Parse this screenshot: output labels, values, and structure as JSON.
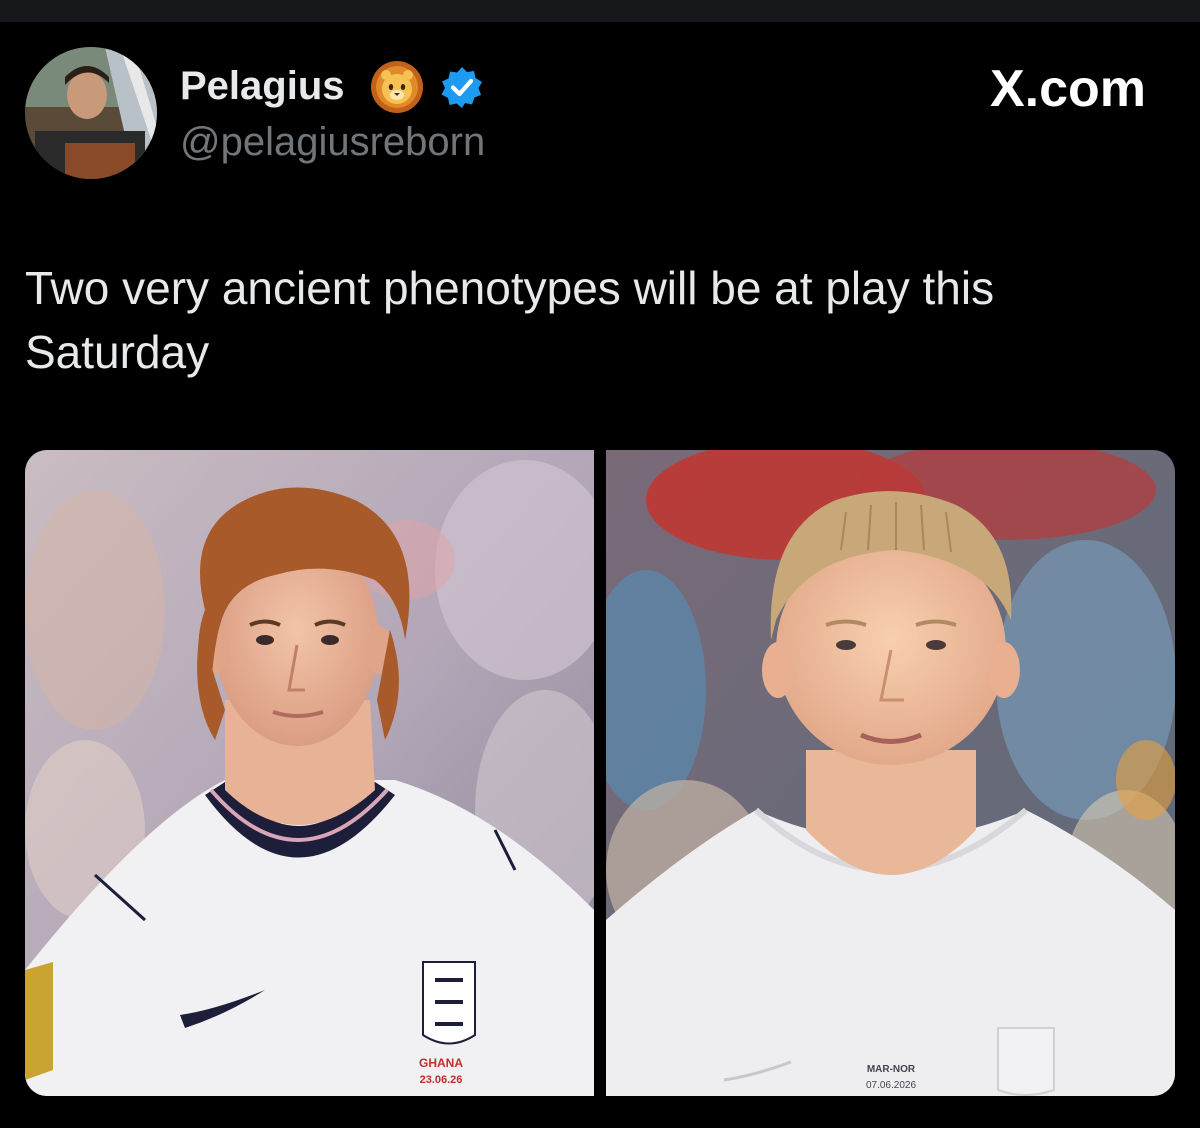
{
  "tweet": {
    "author": {
      "display_name": "Pelagius",
      "handle": "@pelagiusreborn",
      "badge_emoji": "lion-face-icon",
      "verified": true,
      "verified_color": "#1d9bf0"
    },
    "site_mark": "X.com",
    "text": "Two very ancient phenotypes will be at play this Saturday",
    "media": [
      {
        "kind": "photo",
        "shirt_print_line1": "GHANA",
        "shirt_print_line2": "23.06.26"
      },
      {
        "kind": "photo",
        "shirt_print_line1": "MAR-NOR",
        "shirt_print_line2": "07.06.2026"
      }
    ]
  },
  "colors": {
    "background": "#000000",
    "text_primary": "#e7e9ea",
    "text_secondary": "#71767b"
  }
}
